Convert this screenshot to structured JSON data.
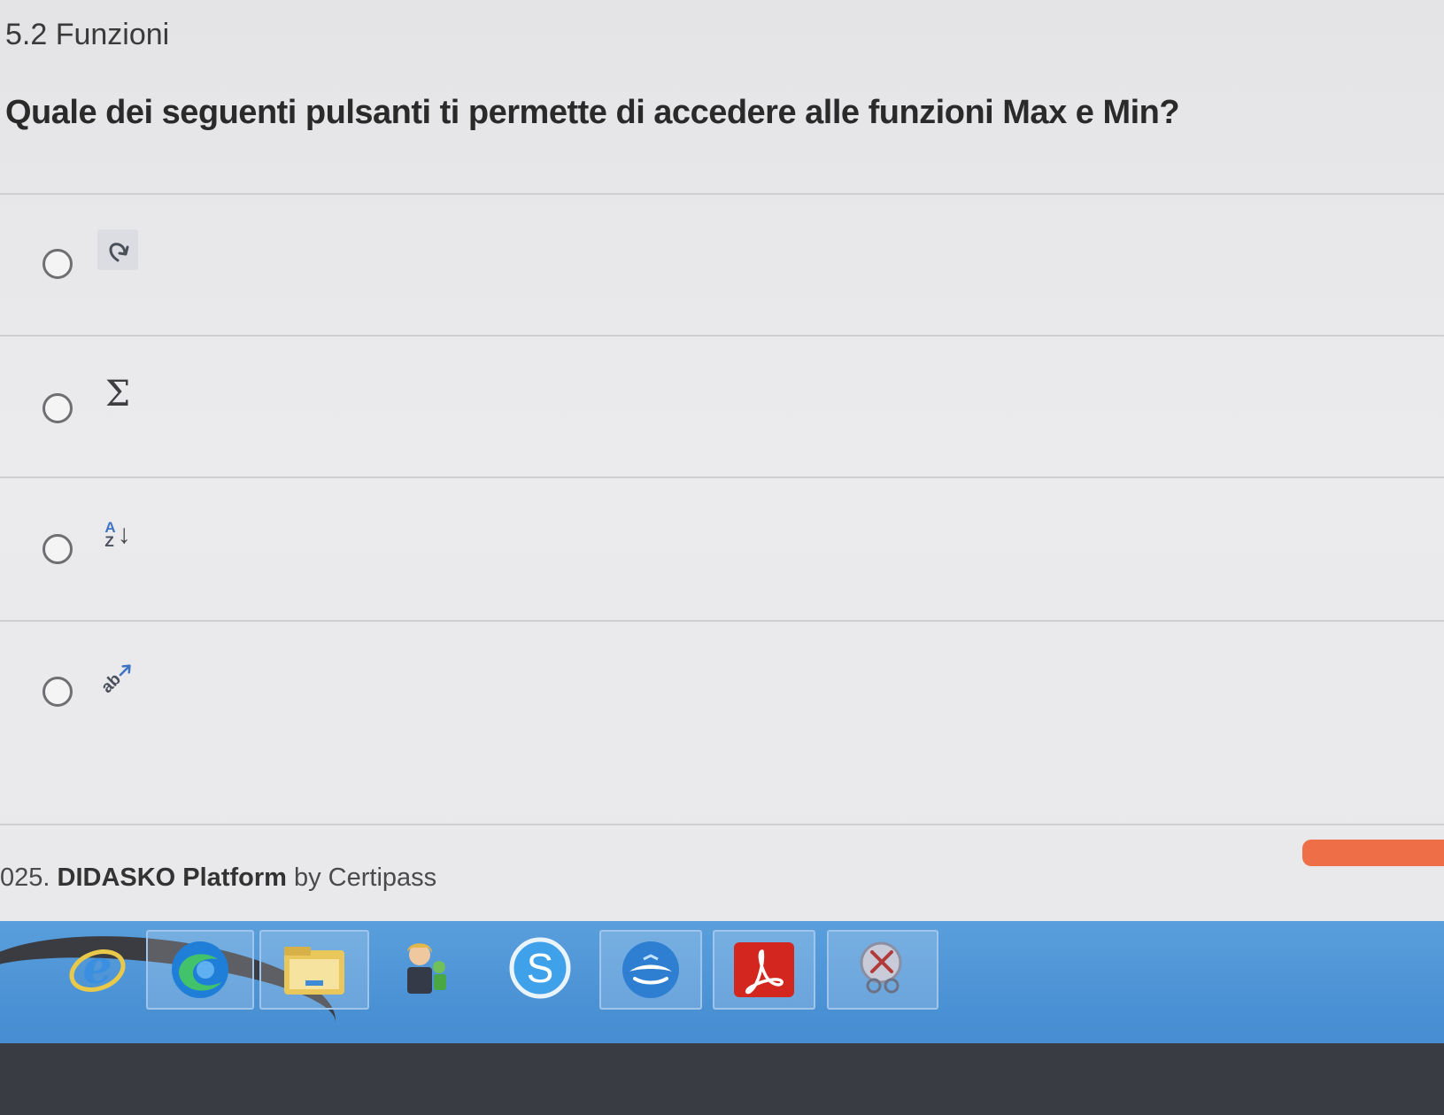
{
  "section": {
    "title": "5.2 Funzioni"
  },
  "question": {
    "text": "Quale dei seguenti pulsanti ti permette di accedere alle funzioni Max e Min?"
  },
  "options": [
    {
      "icon": "redo-arrow-icon",
      "glyph": ""
    },
    {
      "icon": "sigma-autosum-icon",
      "glyph": "Σ"
    },
    {
      "icon": "sort-az-icon",
      "glyph_top": "A",
      "glyph_bottom": "Z",
      "glyph_arrow": "↓"
    },
    {
      "icon": "orientation-ab-icon",
      "glyph": "ab"
    }
  ],
  "footer": {
    "prefix": "025. ",
    "brand": "DIDASKO Platform",
    "suffix": " by Certipass"
  },
  "taskbar": {
    "apps": [
      "internet-explorer-icon",
      "edge-icon",
      "file-explorer-icon",
      "users-icon",
      "skype-icon",
      "thunderbird-icon",
      "acrobat-icon",
      "snipping-tool-icon"
    ]
  },
  "colors": {
    "accent_orange": "#ee6e48",
    "taskbar_blue": "#4a91d4",
    "acrobat_red": "#d2261f"
  }
}
